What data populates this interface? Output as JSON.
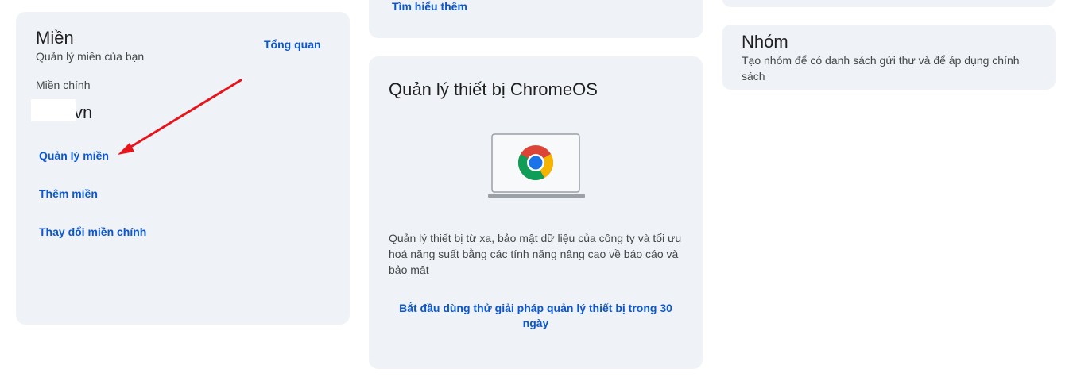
{
  "domain_card": {
    "title": "Miền",
    "subtitle": "Quản lý miền của bạn",
    "overview_link": "Tổng quan",
    "primary_label": "Miền chính",
    "primary_value": "vn",
    "links": [
      "Quản lý miền",
      "Thêm miền",
      "Thay đổi miền chính"
    ]
  },
  "learn_card": {
    "link": "Tìm hiểu thêm"
  },
  "chromeos_card": {
    "title": "Quản lý thiết bị ChromeOS",
    "description": "Quản lý thiết bị từ xa, bảo mật dữ liệu của công ty và tối ưu hoá năng suất bằng các tính năng nâng cao về báo cáo và bảo mật",
    "cta": "Bắt đầu dùng thử giải pháp quản lý thiết bị trong 30 ngày",
    "illustration_icon": "chrome-laptop-icon"
  },
  "groups_card": {
    "title": "Nhóm",
    "description": "Tạo nhóm để có danh sách gửi thư và để áp dụng chính sách"
  },
  "colors": {
    "card_bg": "#eff2f7",
    "link": "#0b57d0",
    "annotation_arrow": "#e8141c"
  }
}
